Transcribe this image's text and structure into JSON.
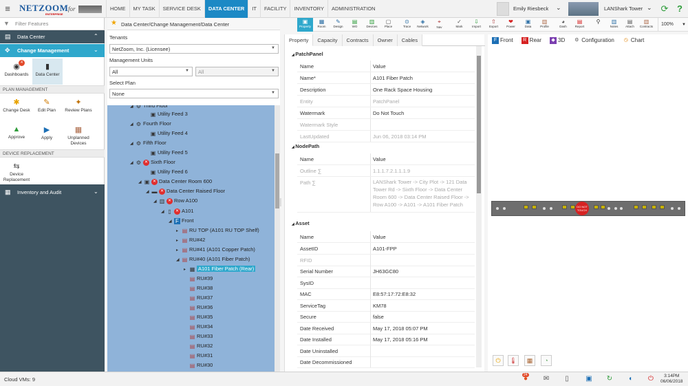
{
  "topbar": {
    "logo_text": "NETZOOM",
    "logo_sub": "ENTERPRISE",
    "logo_for": "for",
    "tabs": [
      {
        "label": "HOME",
        "active": false
      },
      {
        "label": "MY TASK",
        "active": false
      },
      {
        "label": "SERVICE DESK",
        "active": false
      },
      {
        "label": "DATA CENTER",
        "active": true
      },
      {
        "label": "IT",
        "active": false
      },
      {
        "label": "FACILITY",
        "active": false
      },
      {
        "label": "INVENTORY",
        "active": false
      },
      {
        "label": "ADMINISTRATION",
        "active": false
      }
    ],
    "user_name": "Emily Riesbeck",
    "site_name": "LANShark Tower"
  },
  "sidebar": {
    "filter_placeholder": "Filter Features",
    "data_center_label": "Data Center",
    "change_mgmt_label": "Change Management",
    "tiles_top": [
      {
        "label": "Dashboards",
        "badge": "4"
      },
      {
        "label": "Data Center"
      }
    ],
    "plan_mgmt_header": "PLAN MANAGEMENT",
    "plan_tiles": [
      {
        "label": "Change Desk"
      },
      {
        "label": "Edit Plan"
      },
      {
        "label": "Review Plans"
      },
      {
        "label": "Approve"
      },
      {
        "label": "Apply"
      },
      {
        "label": "Unplanned Devices"
      }
    ],
    "device_repl_header": "DEVICE REPLACEMENT",
    "device_repl_tile": "Device Replacement",
    "inventory_label": "Inventory and Audit"
  },
  "tree_panel": {
    "breadcrumb": "Data Center/Change Management/Data Center",
    "tenants_label": "Tenants",
    "tenant_value": "NetZoom, Inc. (Licensee)",
    "mgmt_units_label": "Management Units",
    "mgmt_unit_1": "All",
    "mgmt_unit_2": "All",
    "select_plan_label": "Select Plan",
    "plan_value": "None",
    "nodes": [
      {
        "label": "Third Floor"
      },
      {
        "label": "Utility Feed 3"
      },
      {
        "label": "Fourth Floor"
      },
      {
        "label": "Utility Feed 4"
      },
      {
        "label": "Fifth Floor"
      },
      {
        "label": "Utility Feed 5"
      },
      {
        "label": "Sixth Floor"
      },
      {
        "label": "Utility Feed 6"
      },
      {
        "label": "Data Center Room 600"
      },
      {
        "label": "Data Center Raised Floor"
      },
      {
        "label": "Row A100"
      },
      {
        "label": "A101"
      },
      {
        "label": "Front"
      },
      {
        "label": "RU TOP (A101 RU TOP Shelf)"
      },
      {
        "label": "RU#42"
      },
      {
        "label": "RU#41 (A101 Copper Patch)"
      },
      {
        "label": "RU#40 (A101 Fiber Patch)"
      },
      {
        "label": "A101 Fiber Patch (Rear)"
      },
      {
        "label": "RU#39"
      },
      {
        "label": "RU#38"
      },
      {
        "label": "RU#37"
      },
      {
        "label": "RU#36"
      },
      {
        "label": "RU#35"
      },
      {
        "label": "RU#34"
      },
      {
        "label": "RU#33"
      },
      {
        "label": "RU#32"
      },
      {
        "label": "RU#31"
      },
      {
        "label": "RU#30"
      }
    ]
  },
  "ribbon": {
    "buttons": [
      "Property",
      "Room",
      "Design",
      "WO",
      "Devices",
      "Place",
      "Trace",
      "Network",
      "Nav",
      "Mark",
      "Import",
      "Export",
      "Power",
      "Data",
      "Profile",
      "Dash",
      "Report",
      "",
      "Notes",
      "Attach",
      "Contracts"
    ],
    "zoom": "100%"
  },
  "properties": {
    "tabs": [
      "Property",
      "Capacity",
      "Contracts",
      "Owner",
      "Cables"
    ],
    "patchpanel_header": "PatchPanel",
    "col_name": "Name",
    "col_value": "Value",
    "patchpanel_rows": [
      {
        "k": "Name*",
        "v": "A101 Fiber Patch"
      },
      {
        "k": "Description",
        "v": "One Rack Space Housing"
      },
      {
        "k": "Entity",
        "v": "PatchPanel"
      },
      {
        "k": "Watermark",
        "v": "Do Not Touch"
      },
      {
        "k": "Watermark Style",
        "v": ""
      },
      {
        "k": "LastUpdated",
        "v": "Jun 06, 2018 03:14 PM"
      }
    ],
    "nodepath_header": "NodePath",
    "nodepath_rows": [
      {
        "k": "Outline ∑",
        "v": "1.1.1.7.2.1.1.1.9"
      },
      {
        "k": "Path ∑",
        "v": "LANShark Tower -> City Plot -> 121 Data Tower Rd -> Sixth Floor -> Data Center Room 600 -> Data Center Raised Floor -> Row A100 -> A101 -> A101 Fiber Patch"
      }
    ],
    "asset_header": "Asset",
    "asset_rows": [
      {
        "k": "AssetID",
        "v": "A101-FPP"
      },
      {
        "k": "RFID",
        "v": ""
      },
      {
        "k": "Serial Number",
        "v": "JH63GC80"
      },
      {
        "k": "SysID",
        "v": ""
      },
      {
        "k": "MAC",
        "v": "E8:57:17:72:E8:32"
      },
      {
        "k": "ServiceTag",
        "v": "KM78"
      },
      {
        "k": "Secure",
        "v": "false"
      },
      {
        "k": "Date Received",
        "v": "May 17, 2018 05:07 PM"
      },
      {
        "k": "Date Installed",
        "v": "May 17, 2018 05:16 PM"
      },
      {
        "k": "Date Uninstalled",
        "v": ""
      },
      {
        "k": "Date Decommissioned",
        "v": ""
      }
    ]
  },
  "view": {
    "tabs": [
      "Front",
      "Rear",
      "3D",
      "Configuration",
      "Chart"
    ],
    "watermark": "DO NOT TOUCH"
  },
  "status": {
    "cloud_vms": "Cloud VMs: 9",
    "tray_badge": "24",
    "time": "3:14PM",
    "date": "06/06/2018"
  }
}
